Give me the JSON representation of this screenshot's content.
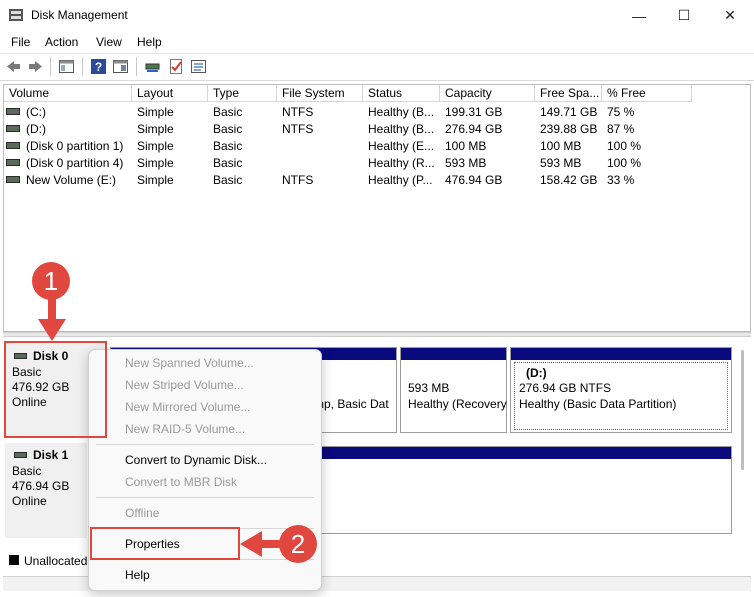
{
  "window": {
    "title": "Disk Management",
    "controls": {
      "minimize": "—",
      "maximize": "☐",
      "close": "✕"
    }
  },
  "menubar": [
    "File",
    "Action",
    "View",
    "Help"
  ],
  "toolbar": {
    "icons": [
      "back-icon",
      "forward-icon",
      "console-icon",
      "help-icon",
      "properties-icon",
      "connect-icon",
      "checklist-icon",
      "list-icon"
    ]
  },
  "volume_table": {
    "columns": [
      "Volume",
      "Layout",
      "Type",
      "File System",
      "Status",
      "Capacity",
      "Free Spa...",
      "% Free"
    ],
    "rows": [
      [
        "(C:)",
        "Simple",
        "Basic",
        "NTFS",
        "Healthy (B...",
        "199.31 GB",
        "149.71 GB",
        "75 %"
      ],
      [
        "(D:)",
        "Simple",
        "Basic",
        "NTFS",
        "Healthy (B...",
        "276.94 GB",
        "239.88 GB",
        "87 %"
      ],
      [
        "(Disk 0 partition 1)",
        "Simple",
        "Basic",
        "",
        "Healthy (E...",
        "100 MB",
        "100 MB",
        "100 %"
      ],
      [
        "(Disk 0 partition 4)",
        "Simple",
        "Basic",
        "",
        "Healthy (R...",
        "593 MB",
        "593 MB",
        "100 %"
      ],
      [
        "New Volume (E:)",
        "Simple",
        "Basic",
        "NTFS",
        "Healthy (P...",
        "476.94 GB",
        "158.42 GB",
        "33 %"
      ]
    ]
  },
  "disks": [
    {
      "name": "Disk 0",
      "type": "Basic",
      "size": "476.92 GB",
      "state": "Online"
    },
    {
      "name": "Disk 1",
      "type": "Basic",
      "size": "476.94 GB",
      "state": "Online"
    }
  ],
  "disk0_partitions": {
    "p_a": "mp, Basic Dat",
    "p_b_size": "593 MB",
    "p_b_status": "Healthy (Recovery",
    "p_c_name": "(D:)",
    "p_c_size": "276.94 GB NTFS",
    "p_c_status": "Healthy (Basic Data Partition)"
  },
  "legend": {
    "unallocated": "Unallocated"
  },
  "context_menu": {
    "items": [
      {
        "label": "New Spanned Volume...",
        "enabled": false
      },
      {
        "label": "New Striped Volume...",
        "enabled": false
      },
      {
        "label": "New Mirrored Volume...",
        "enabled": false
      },
      {
        "label": "New RAID-5 Volume...",
        "enabled": false
      },
      {
        "label": "Convert to Dynamic Disk...",
        "enabled": true
      },
      {
        "label": "Convert to MBR Disk",
        "enabled": false
      },
      {
        "label": "Offline",
        "enabled": false
      },
      {
        "label": "Properties",
        "enabled": true
      },
      {
        "label": "Help",
        "enabled": true
      }
    ]
  },
  "annotations": {
    "step1": "1",
    "step2": "2",
    "color": "#e0473f"
  },
  "colors": {
    "partition_bar": "#0a0a7e",
    "accent_red": "#e0473f"
  }
}
